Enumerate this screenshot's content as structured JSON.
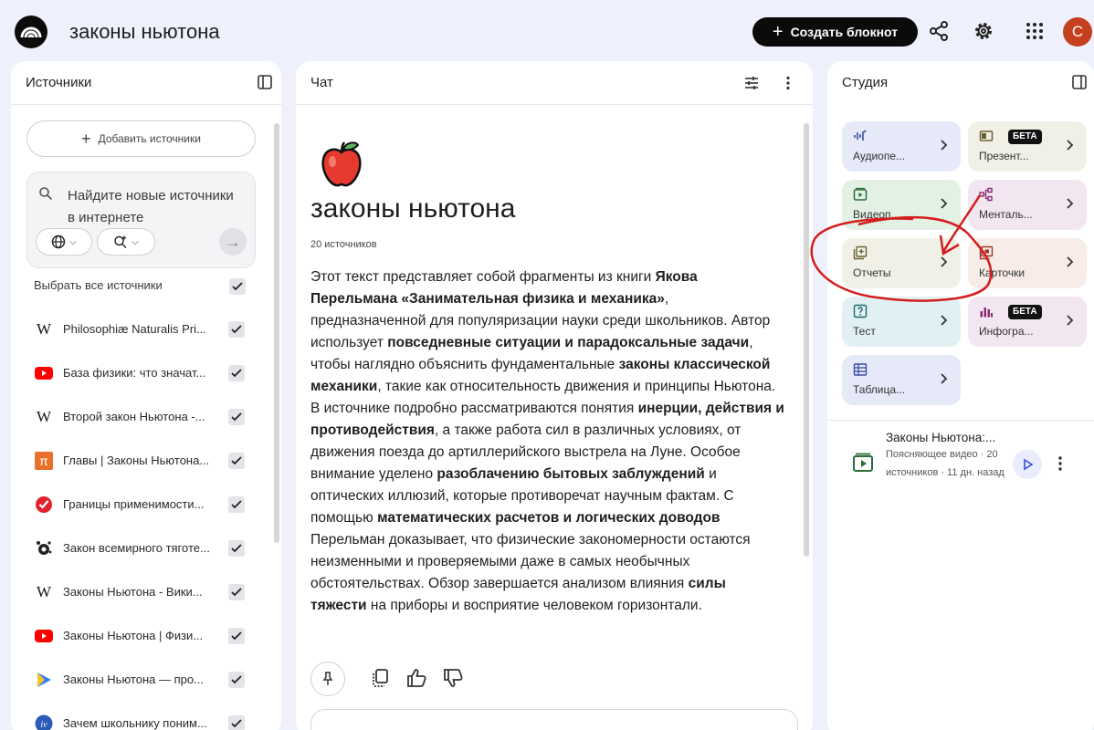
{
  "header": {
    "notebook_title": "законы ньютона",
    "create_button": "Создать блокнот",
    "avatar_letter": "С"
  },
  "sources_panel": {
    "title": "Источники",
    "add_button": "Добавить источники",
    "search_placeholder": "Найдите новые источники в интернете",
    "select_all": "Выбрать все источники",
    "items": [
      {
        "icon": "wikipedia-icon",
        "label": "Philosophiæ Naturalis Pri..."
      },
      {
        "icon": "youtube-icon",
        "label": "База физики: что значат..."
      },
      {
        "icon": "wikipedia-icon",
        "label": "Второй закон Ньютона -..."
      },
      {
        "icon": "pi-icon",
        "label": "Главы | Законы Ньютона..."
      },
      {
        "icon": "checkmark-logo-icon",
        "label": "Границы применимости..."
      },
      {
        "icon": "site-logo-icon",
        "label": "Закон всемирного тяготе..."
      },
      {
        "icon": "wikipedia-icon",
        "label": "Законы Ньютона - Вики..."
      },
      {
        "icon": "youtube-icon",
        "label": "Законы Ньютона | Физи..."
      },
      {
        "icon": "play-logo-icon",
        "label": "Законы Ньютона — про..."
      },
      {
        "icon": "school-logo-icon",
        "label": "Зачем школьнику поним..."
      }
    ]
  },
  "chat_panel": {
    "title": "Чат",
    "notebook_title": "законы ньютона",
    "source_count": "20 источников",
    "summary": [
      {
        "t": "Этот текст представляет собой фрагменты из книги ",
        "b": false
      },
      {
        "t": "Якова Перельмана «Занимательная физика и механика»",
        "b": true
      },
      {
        "t": ", предназначенной для популяризации науки среди школьников. Автор использует ",
        "b": false
      },
      {
        "t": "повседневные ситуации и парадоксальные задачи",
        "b": true
      },
      {
        "t": ", чтобы наглядно объяснить фундаментальные ",
        "b": false
      },
      {
        "t": "законы классической механики",
        "b": true
      },
      {
        "t": ", такие как относительность движения и принципы Ньютона. В источнике подробно рассматриваются понятия ",
        "b": false
      },
      {
        "t": "инерции, действия и противодействия",
        "b": true
      },
      {
        "t": ", а также работа сил в различных условиях, от движения поезда до артиллерийского выстрела на Луне. Особое внимание уделено ",
        "b": false
      },
      {
        "t": "разоблачению бытовых заблуждений",
        "b": true
      },
      {
        "t": " и оптических иллюзий, которые противоречат научным фактам. С помощью ",
        "b": false
      },
      {
        "t": "математических расчетов и логических доводов",
        "b": true
      },
      {
        "t": " Перельман доказывает, что физические закономерности остаются неизменными и проверяемыми даже в самых необычных обстоятельствах. Обзор завершается анализом влияния ",
        "b": false
      },
      {
        "t": "силы тяжести",
        "b": true
      },
      {
        "t": " на приборы и восприятие человеком горизонтали.",
        "b": false
      }
    ]
  },
  "studio_panel": {
    "title": "Студия",
    "beta_label": "БЕТА",
    "tiles": [
      {
        "label": "Аудиопе...",
        "icon": "audio-overview-icon"
      },
      {
        "label": "Презент...",
        "icon": "presentation-icon"
      },
      {
        "label": "Видеоп...",
        "icon": "video-overview-icon"
      },
      {
        "label": "Менталь...",
        "icon": "mind-map-icon"
      },
      {
        "label": "Отчеты",
        "icon": "reports-icon"
      },
      {
        "label": "Карточки",
        "icon": "flashcards-icon"
      },
      {
        "label": "Тест",
        "icon": "quiz-icon"
      },
      {
        "label": "Инфогра...",
        "icon": "infographic-icon"
      },
      {
        "label": "Таблица...",
        "icon": "table-icon"
      }
    ],
    "generated_item": {
      "title": "Законы Ньютона:...",
      "meta": "Поясняющее видео · 20 источников · 11 дн. назад"
    }
  },
  "colors": {
    "accent": "#0b0b0b",
    "avatar": "#c4401e",
    "annotation": "#d41d1d",
    "page_bg": "#eef0fb"
  }
}
